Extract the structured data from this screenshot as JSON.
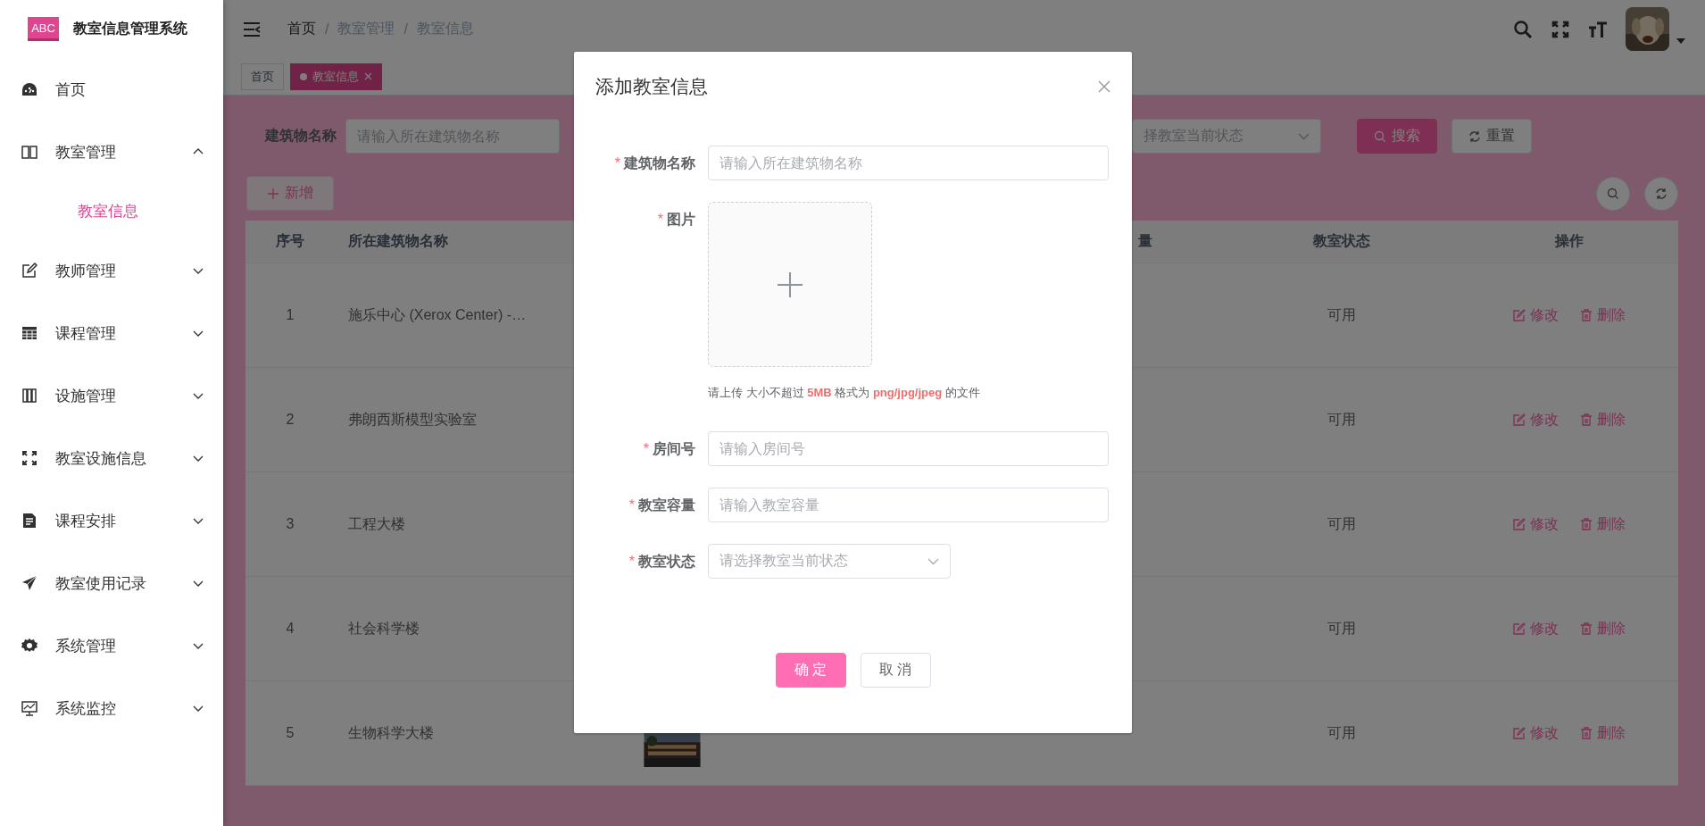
{
  "app": {
    "logo_text": "ABC",
    "title": "教室信息管理系统"
  },
  "sidebar": {
    "items": [
      {
        "label": "首页",
        "kind": "link",
        "selected": false
      },
      {
        "label": "教室管理",
        "kind": "submenu",
        "expanded": true,
        "selected": false,
        "children": [
          {
            "label": "教室信息",
            "selected": true
          }
        ]
      },
      {
        "label": "教师管理",
        "kind": "submenu",
        "expanded": false,
        "selected": false
      },
      {
        "label": "课程管理",
        "kind": "submenu",
        "expanded": false,
        "selected": false
      },
      {
        "label": "设施管理",
        "kind": "submenu",
        "expanded": false,
        "selected": false
      },
      {
        "label": "教室设施信息",
        "kind": "submenu",
        "expanded": false,
        "selected": false
      },
      {
        "label": "课程安排",
        "kind": "submenu",
        "expanded": false,
        "selected": false
      },
      {
        "label": "教室使用记录",
        "kind": "submenu",
        "expanded": false,
        "selected": false
      },
      {
        "label": "系统管理",
        "kind": "submenu",
        "expanded": false,
        "selected": false
      },
      {
        "label": "系统监控",
        "kind": "submenu",
        "expanded": false,
        "selected": false
      }
    ]
  },
  "header": {
    "breadcrumb": [
      {
        "label": "首页"
      },
      {
        "label": "教室管理"
      },
      {
        "label": "教室信息"
      }
    ],
    "separator": "/"
  },
  "tags": [
    {
      "label": "首页",
      "selected": false
    },
    {
      "label": "教室信息",
      "selected": true,
      "closable": true
    }
  ],
  "search": {
    "fields": [
      {
        "label": "建筑物名称",
        "placeholder": "请输入所在建筑物名称"
      }
    ],
    "status_select": {
      "placeholder": "择教室当前状态"
    },
    "buttons": [
      {
        "label": "搜索",
        "kind": "primary"
      },
      {
        "label": "重置",
        "kind": "default"
      }
    ]
  },
  "toolbar": {
    "add_button": "新增"
  },
  "table": {
    "columns": {
      "index": "序号",
      "building": "所在建筑物名称",
      "capacity": "量",
      "status": "教室状态",
      "actions": "操作"
    },
    "rows": [
      {
        "index": "1",
        "building": "施乐中心 (Xerox Center) -…",
        "status": "可用",
        "actions": [
          {
            "label": "修改",
            "kind": "edit"
          },
          {
            "label": "删除",
            "kind": "delete"
          }
        ]
      },
      {
        "index": "2",
        "building": "弗朗西斯模型实验室",
        "status": "可用",
        "actions": [
          {
            "label": "修改",
            "kind": "edit"
          },
          {
            "label": "删除",
            "kind": "delete"
          }
        ]
      },
      {
        "index": "3",
        "building": "工程大楼",
        "status": "可用",
        "actions": [
          {
            "label": "修改",
            "kind": "edit"
          },
          {
            "label": "删除",
            "kind": "delete"
          }
        ]
      },
      {
        "index": "4",
        "building": "社会科学楼",
        "status": "可用",
        "actions": [
          {
            "label": "修改",
            "kind": "edit"
          },
          {
            "label": "删除",
            "kind": "delete"
          }
        ]
      },
      {
        "index": "5",
        "building": "生物科学大楼",
        "column_3": {
          "kind": "picture"
        },
        "status": "可用",
        "actions": [
          {
            "label": "修改",
            "kind": "edit"
          },
          {
            "label": "删除",
            "kind": "delete"
          }
        ]
      }
    ]
  },
  "dialog": {
    "title": "添加教室信息",
    "required_mark": "*",
    "fields": [
      {
        "kind": "input",
        "label": "建筑物名称",
        "required": true,
        "placeholder": "请输入所在建筑物名称"
      },
      {
        "kind": "upload",
        "label": "图片",
        "required": true,
        "hint": "请上传 大小不超过 **5MB** 格式为 **png/jpg/jpeg** 的文件"
      },
      {
        "kind": "input",
        "label": "房间号",
        "required": true,
        "placeholder": "请输入房间号"
      },
      {
        "kind": "input",
        "label": "教室容量",
        "required": true,
        "placeholder": "请输入教室容量"
      },
      {
        "kind": "select",
        "label": "教室状态",
        "required": true,
        "placeholder": "请选择教室当前状态"
      }
    ],
    "buttons": [
      {
        "label": "确 定",
        "kind": "primary"
      },
      {
        "label": "取 消",
        "kind": "default"
      }
    ]
  }
}
